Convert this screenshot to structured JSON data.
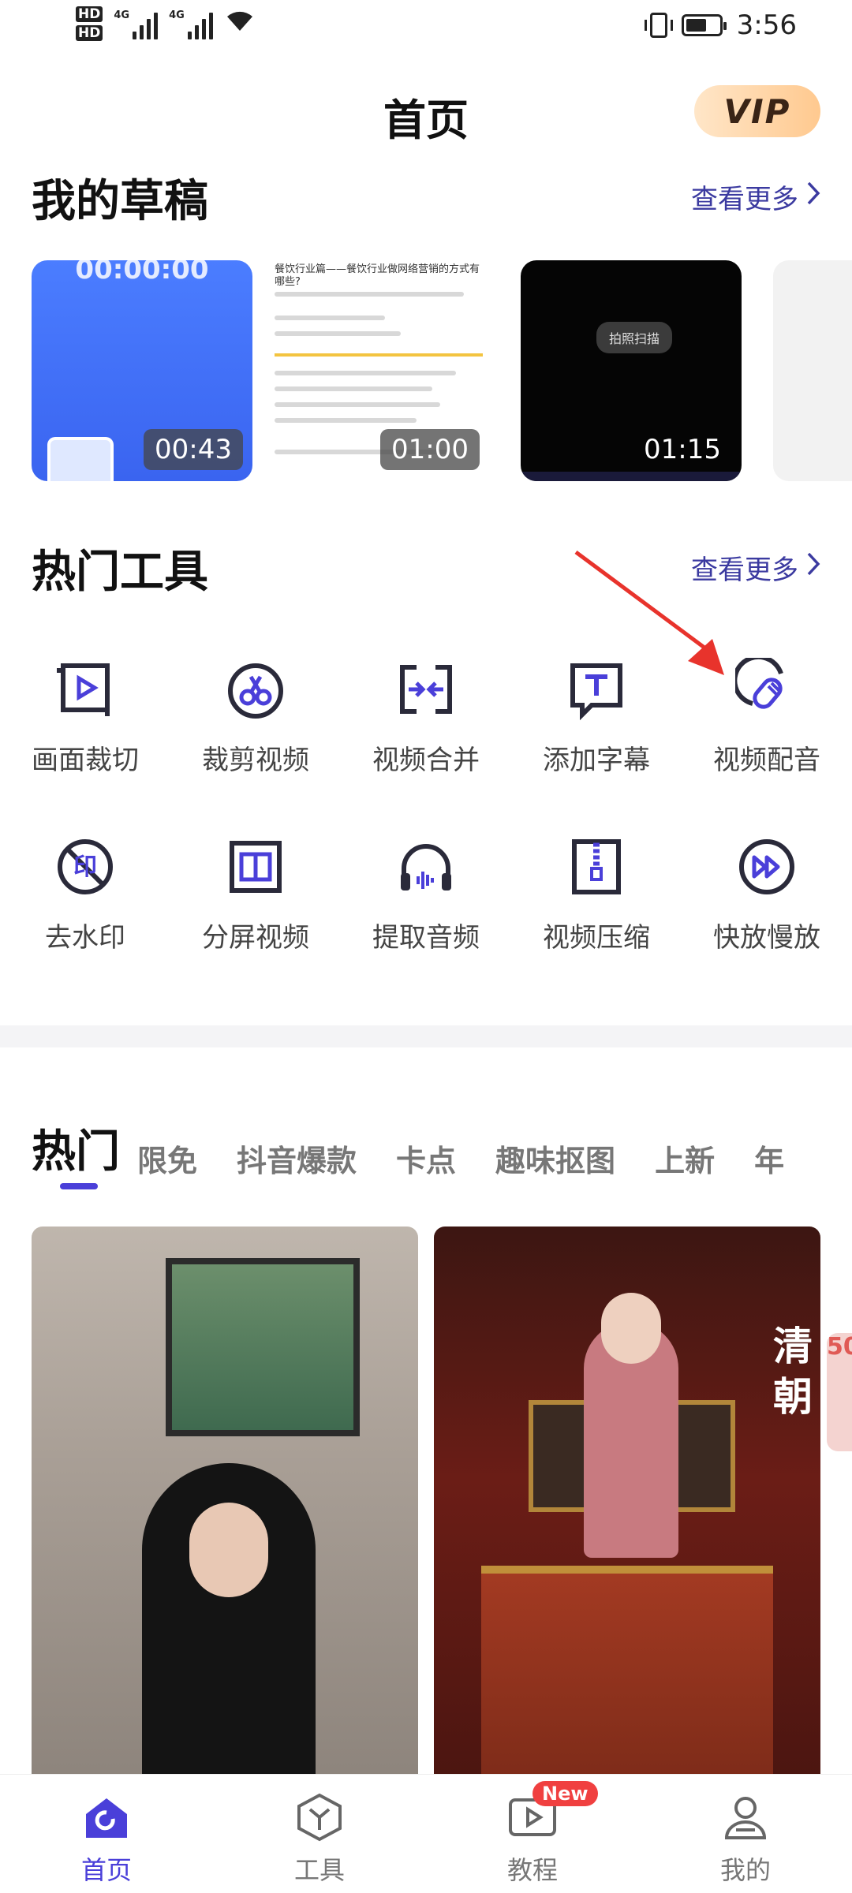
{
  "status_bar": {
    "hd1": "HD",
    "hd2": "HD",
    "net1": "4G",
    "net2": "4G",
    "time": "3:56"
  },
  "header": {
    "title": "首页",
    "vip_label": "VIP"
  },
  "drafts": {
    "title": "我的草稿",
    "more": "查看更多",
    "items": [
      {
        "duration": "00:43",
        "overlay_text": "00:00:00"
      },
      {
        "duration": "01:00",
        "headline": "餐饮行业篇——餐饮行业做网络营销的方式有哪些?"
      },
      {
        "duration": "01:15",
        "overlay_text": "拍照扫描"
      }
    ]
  },
  "tools": {
    "title": "热门工具",
    "more": "查看更多",
    "items": [
      {
        "label": "画面裁切",
        "icon": "crop-play-icon"
      },
      {
        "label": "裁剪视频",
        "icon": "scissors-icon"
      },
      {
        "label": "视频合并",
        "icon": "merge-icon"
      },
      {
        "label": "添加字幕",
        "icon": "subtitle-icon"
      },
      {
        "label": "视频配音",
        "icon": "microphone-icon"
      },
      {
        "label": "去水印",
        "icon": "watermark-remove-icon"
      },
      {
        "label": "分屏视频",
        "icon": "split-screen-icon"
      },
      {
        "label": "提取音频",
        "icon": "headphones-icon"
      },
      {
        "label": "视频压缩",
        "icon": "zip-icon"
      },
      {
        "label": "快放慢放",
        "icon": "speed-icon"
      }
    ]
  },
  "tabs": [
    "热门",
    "限免",
    "抖音爆款",
    "卡点",
    "趣味抠图",
    "上新",
    "年"
  ],
  "feed": {
    "card2_caption_1": "清",
    "card2_caption_2": "朝",
    "side_badge": "50"
  },
  "bottom_nav": {
    "items": [
      {
        "label": "首页",
        "icon": "home-icon",
        "active": true
      },
      {
        "label": "工具",
        "icon": "tools-icon",
        "active": false
      },
      {
        "label": "教程",
        "icon": "tutorial-icon",
        "active": false,
        "badge": "New"
      },
      {
        "label": "我的",
        "icon": "profile-icon",
        "active": false
      }
    ]
  },
  "colors": {
    "accent": "#4a3fd9",
    "link": "#3b3aa0",
    "annotation_arrow": "#e8332c"
  }
}
